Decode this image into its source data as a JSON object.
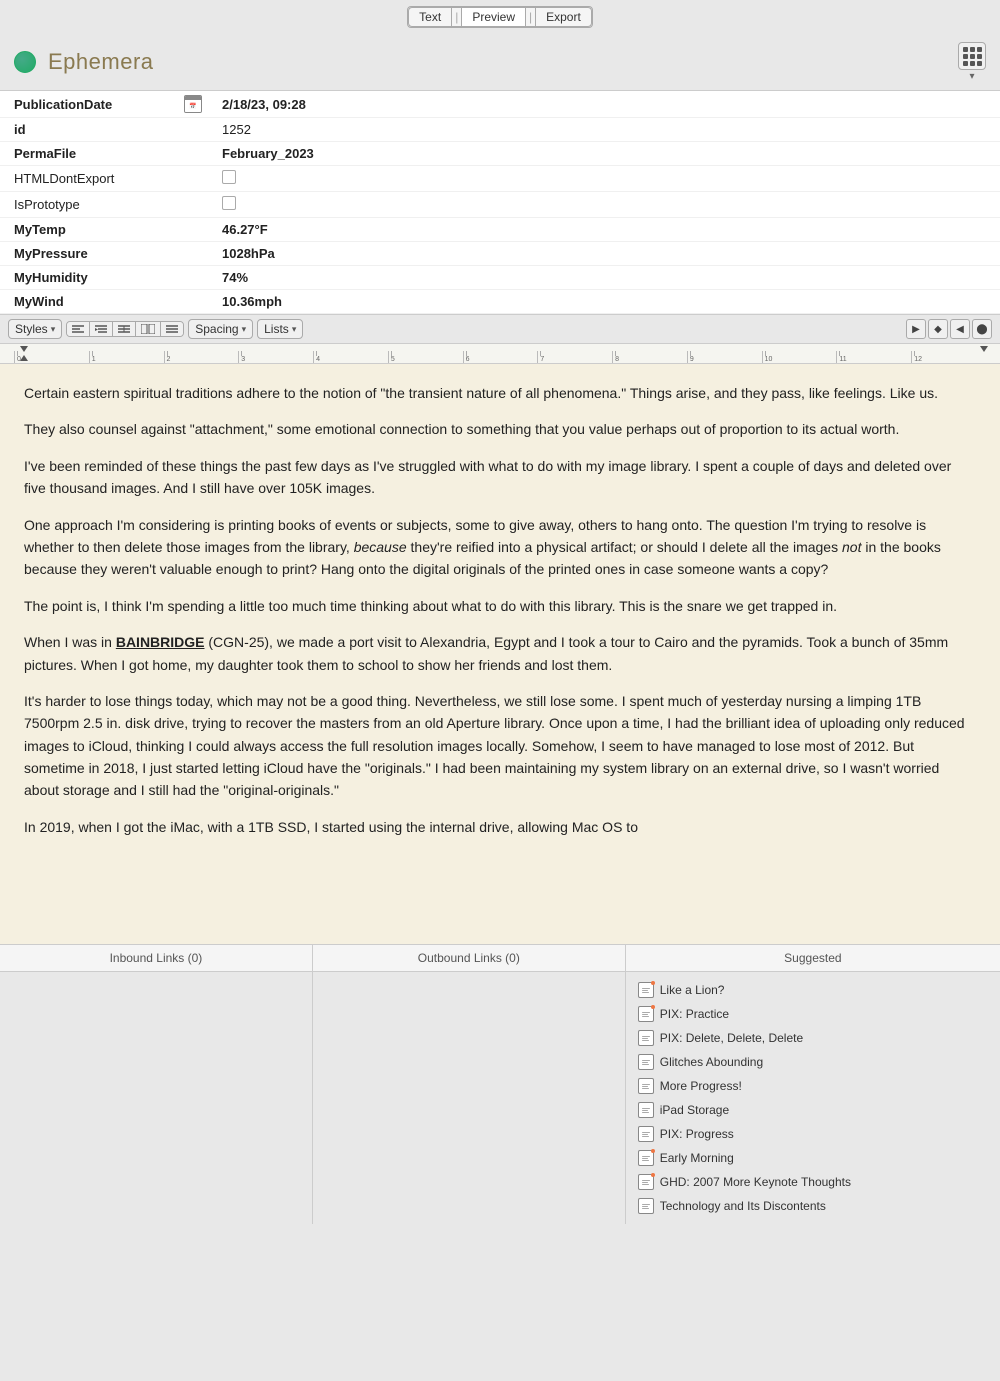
{
  "topBar": {
    "tabs": [
      {
        "label": "Text",
        "active": false
      },
      {
        "label": "Preview",
        "active": true
      },
      {
        "label": "Export",
        "active": false
      }
    ]
  },
  "header": {
    "title": "Ephemera"
  },
  "toolbar": {
    "stylesLabel": "Styles",
    "spacingLabel": "Spacing",
    "listsLabel": "Lists"
  },
  "metadata": [
    {
      "field": "PublicationDate",
      "icon": "calendar",
      "value": "2/18/23, 09:28",
      "bold": true
    },
    {
      "field": "id",
      "icon": null,
      "value": "1252",
      "bold": false
    },
    {
      "field": "PermaFile",
      "icon": null,
      "value": "February_2023",
      "bold": true
    },
    {
      "field": "HTMLDontExport",
      "icon": null,
      "value": "checkbox",
      "bold": false
    },
    {
      "field": "IsPrototype",
      "icon": null,
      "value": "checkbox",
      "bold": false
    },
    {
      "field": "MyTemp",
      "icon": null,
      "value": "46.27°F",
      "bold": true
    },
    {
      "field": "MyPressure",
      "icon": null,
      "value": "1028hPa",
      "bold": true
    },
    {
      "field": "MyHumidity",
      "icon": null,
      "value": "74%",
      "bold": true
    },
    {
      "field": "MyWind",
      "icon": null,
      "value": "10.36mph",
      "bold": true
    }
  ],
  "ruler": {
    "marks": [
      "0",
      "1",
      "2",
      "3",
      "4",
      "5",
      "6",
      "7",
      "8",
      "9",
      "10",
      "11",
      "12"
    ]
  },
  "content": {
    "paragraphs": [
      "Certain eastern spiritual traditions adhere to the notion of \"the transient nature of all phenomena.\" Things arise, and they pass, like feelings. Like us.",
      "They also counsel against \"attachment,\" some emotional connection to something that you value perhaps out of proportion to its actual worth.",
      "I've been reminded of these things the past few days as I've struggled with what to do with my image library. I spent a couple of days and deleted over five thousand images. And I still have over 105K images.",
      "One approach I'm considering is printing books of events or subjects, some to give away, others to hang onto. The question I'm trying to resolve is whether to then delete those images from the library, __because__ they're reified into a physical artifact; or should I delete all the images __not__ in the books because they weren't valuable enough to print? Hang onto the digital originals of the printed ones in case someone wants a copy?",
      "The point is, I think I'm spending a little too much time thinking about what to do with this library. This is the snare we get trapped in.",
      "When I was in BAINBRIDGE (CGN-25), we made a port visit to Alexandria, Egypt and I took a tour to Cairo and the pyramids. Took a bunch of 35mm pictures. When I got home, my daughter took them to school to show her friends and lost them.",
      "It's harder to lose things today, which may not be a good thing. Nevertheless, we still lose some. I spent much of yesterday nursing a limping 1TB 7500rpm 2.5 in. disk drive, trying to recover the masters from an old Aperture library. Once upon a time, I had the brilliant idea of uploading only reduced images to iCloud, thinking I could always access the full resolution images locally. Somehow, I seem to have managed to lose most of 2012. But sometime in 2018, I just started letting iCloud have the \"originals.\" I had been maintaining my system library on an external drive, so I wasn't worried about storage and I still had the \"original-originals.\"",
      "In 2019, when I got the iMac, with a 1TB SSD, I started using the internal drive, allowing Mac OS to"
    ]
  },
  "bottomPanels": {
    "inbound": {
      "label": "Inbound Links (0)"
    },
    "outbound": {
      "label": "Outbound Links (0)"
    },
    "suggested": {
      "label": "Suggested",
      "items": [
        {
          "title": "Like a Lion?",
          "hasDot": true
        },
        {
          "title": "PIX: Practice",
          "hasDot": true
        },
        {
          "title": "PIX: Delete, Delete, Delete",
          "hasDot": false
        },
        {
          "title": "Glitches Abounding",
          "hasDot": false
        },
        {
          "title": "More Progress!",
          "hasDot": false
        },
        {
          "title": "iPad Storage",
          "hasDot": false
        },
        {
          "title": "PIX: Progress",
          "hasDot": false
        },
        {
          "title": "Early Morning",
          "hasDot": true
        },
        {
          "title": "GHD: 2007 More Keynote Thoughts",
          "hasDot": true
        },
        {
          "title": "Technology and Its Discontents",
          "hasDot": false
        }
      ]
    }
  }
}
